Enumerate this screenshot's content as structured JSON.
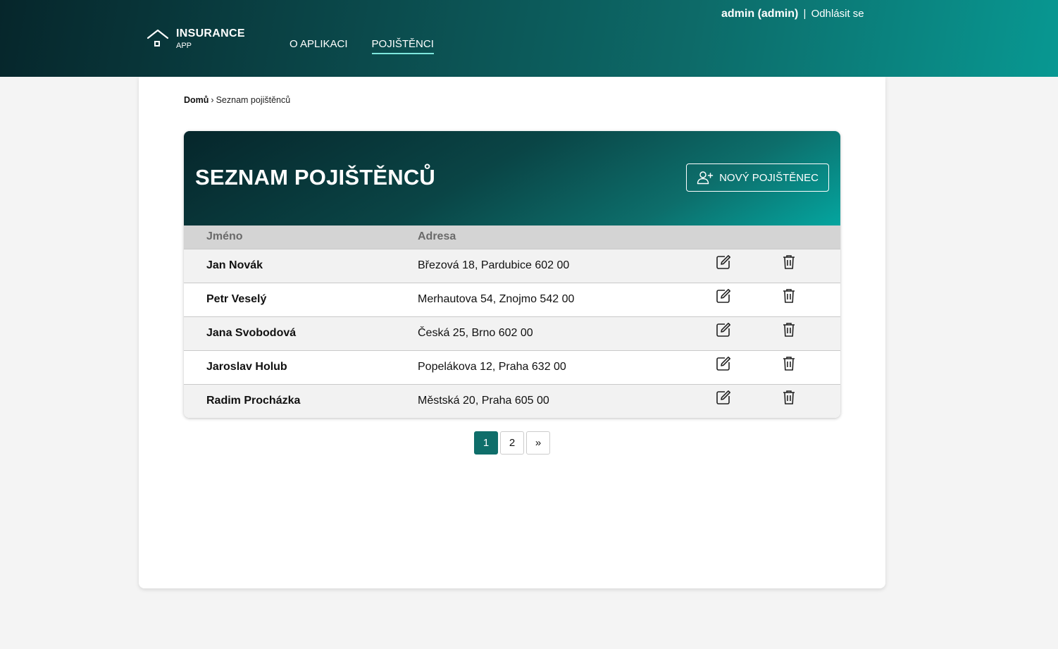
{
  "brand": {
    "name": "INSURANCE",
    "sub": "APP",
    "icon": "house-icon"
  },
  "nav": {
    "items": [
      {
        "label": "O APLIKACI"
      },
      {
        "label": "POJIŠTĚNCI",
        "active": true
      }
    ]
  },
  "user": {
    "name": "admin (admin)",
    "separator": "|",
    "logout": "Odhlásit se"
  },
  "breadcrumb": {
    "home": "Domů",
    "separator": "›",
    "current": "Seznam pojištěnců"
  },
  "panel": {
    "title": "SEZNAM POJIŠTĚNCŮ",
    "new_button": {
      "label": "NOVÝ POJIŠTĚNEC",
      "icon": "add-user-icon"
    }
  },
  "table": {
    "headers": [
      "Jméno",
      "Adresa"
    ],
    "rows": [
      {
        "name": "Jan Novák",
        "address": "Březová 18, Pardubice 602 00"
      },
      {
        "name": "Petr Veselý",
        "address": "Merhautova 54, Znojmo 542 00"
      },
      {
        "name": "Jana Svobodová",
        "address": "Česká 25, Brno 602 00"
      },
      {
        "name": "Jaroslav Holub",
        "address": "Popelákova 12, Praha 632 00"
      },
      {
        "name": "Radim Procházka",
        "address": "Městská 20, Praha 605 00"
      }
    ],
    "row_actions": [
      "edit-icon",
      "trash-icon"
    ]
  },
  "pagination": {
    "pages": [
      "1",
      "2"
    ],
    "current": "1",
    "next": "»"
  },
  "colors": {
    "accent": "#0f6e6a",
    "header_dark": "#06262b",
    "header_light": "#089892"
  }
}
